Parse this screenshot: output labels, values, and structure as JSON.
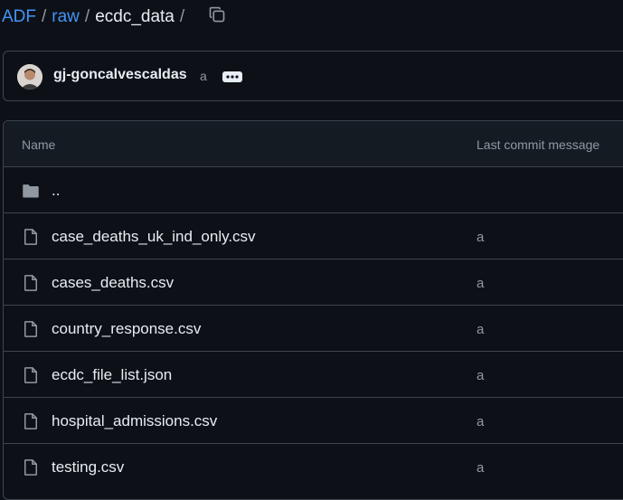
{
  "breadcrumb": {
    "items": [
      "ADF",
      "raw"
    ],
    "current": "ecdc_data",
    "separator": "/"
  },
  "commit": {
    "author": "gj-goncalvescaldas",
    "message": "a"
  },
  "table": {
    "headers": {
      "name": "Name",
      "message": "Last commit message"
    },
    "parent": {
      "name": "..",
      "icon": "folder-icon"
    },
    "files": [
      {
        "name": "case_deaths_uk_ind_only.csv",
        "message": "a"
      },
      {
        "name": "cases_deaths.csv",
        "message": "a"
      },
      {
        "name": "country_response.csv",
        "message": "a"
      },
      {
        "name": "ecdc_file_list.json",
        "message": "a"
      },
      {
        "name": "hospital_admissions.csv",
        "message": "a"
      },
      {
        "name": "testing.csv",
        "message": "a"
      }
    ]
  },
  "colors": {
    "background": "#0d1117",
    "link": "#4493f8",
    "border": "#3d444d",
    "muted": "#9198a1"
  }
}
